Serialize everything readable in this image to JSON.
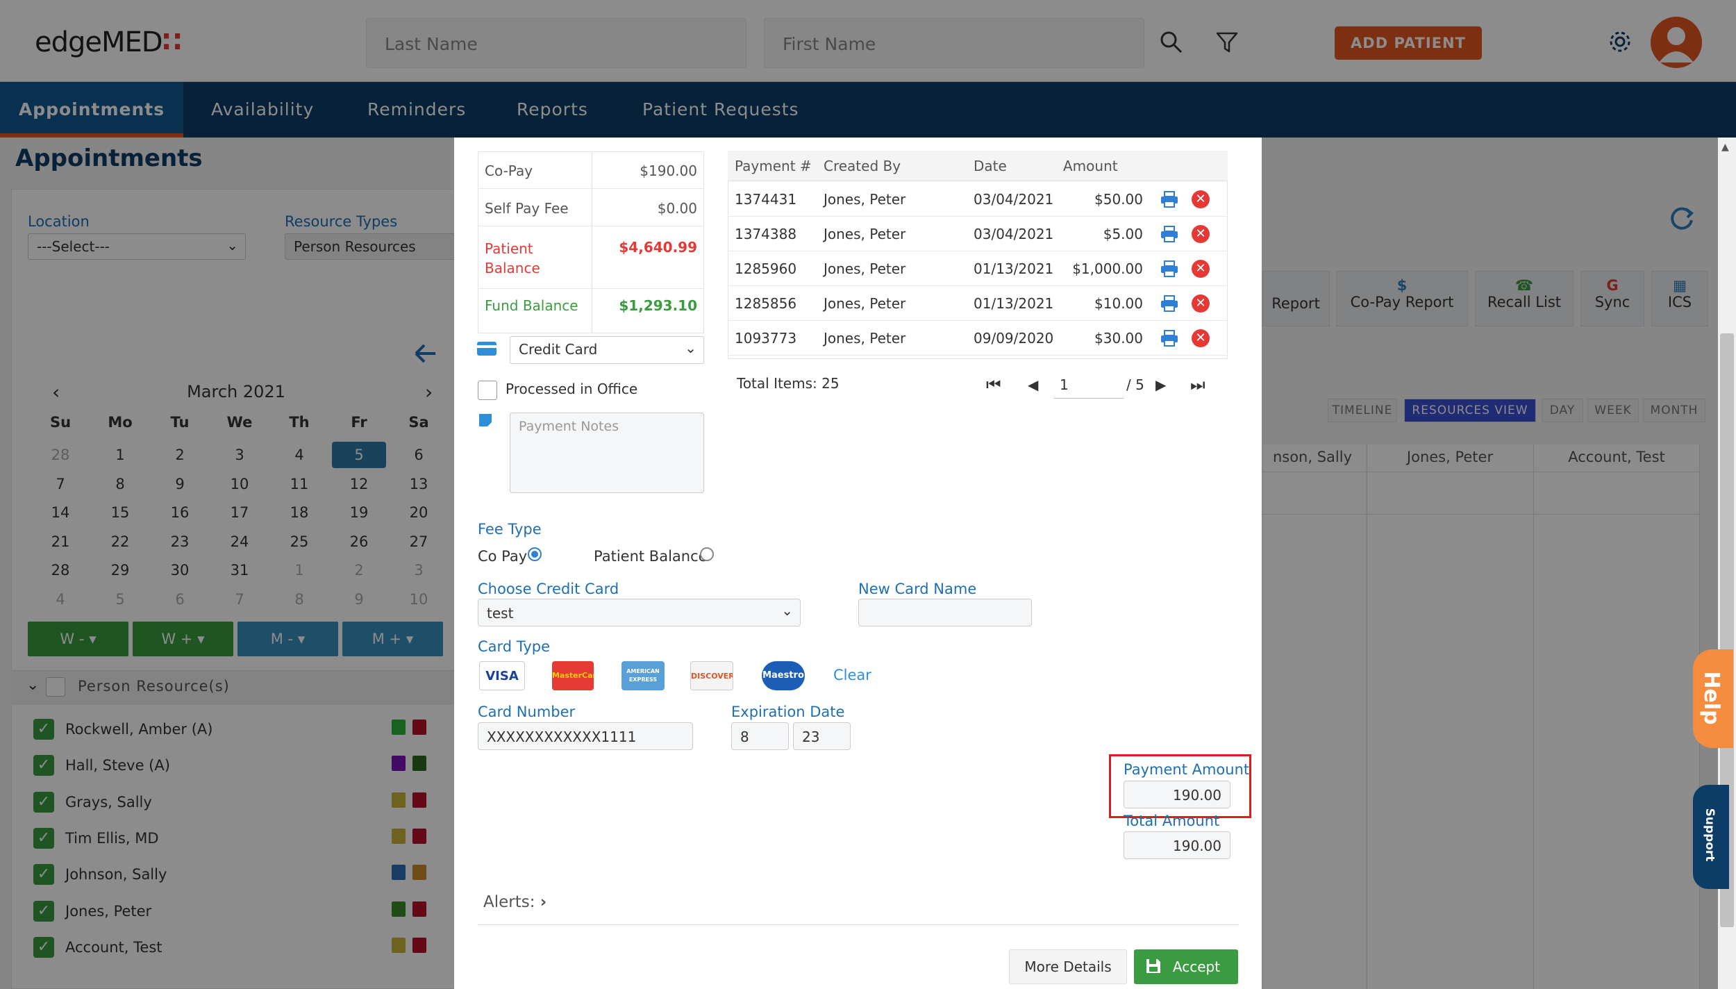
{
  "header": {
    "logo_text": "edgeMED",
    "last_name_placeholder": "Last Name",
    "first_name_placeholder": "First Name",
    "add_patient": "ADD PATIENT"
  },
  "nav": [
    "Appointments",
    "Availability",
    "Reminders",
    "Reports",
    "Patient Requests"
  ],
  "page": {
    "title": "Appointments",
    "location_label": "Location",
    "location_value": "---Select---",
    "resource_types_label": "Resource Types",
    "resource_types_value": "Person Resources",
    "calendar": {
      "month": "March 2021",
      "days": [
        "Su",
        "Mo",
        "Tu",
        "We",
        "Th",
        "Fr",
        "Sa"
      ],
      "weeks": [
        [
          "28",
          "1",
          "2",
          "3",
          "4",
          "5",
          "6"
        ],
        [
          "7",
          "8",
          "9",
          "10",
          "11",
          "12",
          "13"
        ],
        [
          "14",
          "15",
          "16",
          "17",
          "18",
          "19",
          "20"
        ],
        [
          "21",
          "22",
          "23",
          "24",
          "25",
          "26",
          "27"
        ],
        [
          "28",
          "29",
          "30",
          "31",
          "1",
          "2",
          "3"
        ],
        [
          "4",
          "5",
          "6",
          "7",
          "8",
          "9",
          "10"
        ]
      ],
      "selected": "5"
    },
    "week_buttons": [
      "W -",
      "W +",
      "M -",
      "M +"
    ],
    "resources_header": "Person Resource(s)",
    "resources": [
      "Rockwell, Amber (A)",
      "Hall, Steve (A)",
      "Grays, Sally",
      "Tim Ellis, MD",
      "Johnson, Sally",
      "Jones, Peter",
      "Account, Test"
    ],
    "resource_colors": [
      [
        "#2db33a",
        "#b5122a"
      ],
      [
        "#7a14b8",
        "#2f6b1d"
      ],
      [
        "#c9b23a",
        "#b5122a"
      ],
      [
        "#c9b23a",
        "#b5122a"
      ],
      [
        "#2f6fb3",
        "#c98a2a"
      ],
      [
        "#3a8a2a",
        "#b5122a"
      ],
      [
        "#c9b23a",
        "#b5122a"
      ]
    ],
    "report_buttons": [
      "Report",
      "Co-Pay Report",
      "Recall List",
      "Sync",
      "ICS"
    ],
    "view_buttons": [
      "TIMELINE",
      "RESOURCES VIEW",
      "DAY",
      "WEEK",
      "MONTH"
    ],
    "grid_headers": [
      "nson, Sally",
      "Jones, Peter",
      "Account, Test"
    ],
    "help": "Help",
    "support": "Support"
  },
  "modal": {
    "summary": [
      {
        "label": "Co-Pay",
        "value": "$190.00"
      },
      {
        "label": "Self Pay Fee",
        "value": "$0.00"
      },
      {
        "label": "Patient Balance",
        "value": "$4,640.99"
      },
      {
        "label": "Fund Balance",
        "value": "$1,293.10"
      }
    ],
    "payment_method": "Credit Card",
    "processed_in_office": "Processed in Office",
    "payment_notes_placeholder": "Payment Notes",
    "table": {
      "headers": [
        "Payment #",
        "Created By",
        "Date",
        "Amount"
      ],
      "rows": [
        [
          "1374431",
          "Jones, Peter",
          "03/04/2021",
          "$50.00"
        ],
        [
          "1374388",
          "Jones, Peter",
          "03/04/2021",
          "$5.00"
        ],
        [
          "1285960",
          "Jones, Peter",
          "01/13/2021",
          "$1,000.00"
        ],
        [
          "1285856",
          "Jones, Peter",
          "01/13/2021",
          "$10.00"
        ],
        [
          "1093773",
          "Jones, Peter",
          "09/09/2020",
          "$30.00"
        ]
      ],
      "total_items": "Total Items: 25",
      "page": "1",
      "page_total": "/ 5"
    },
    "fee_type_label": "Fee Type",
    "fee_copay": "Co Pay",
    "fee_patient_balance": "Patient Balance",
    "choose_card_label": "Choose Credit Card",
    "choose_card_value": "test",
    "new_card_name_label": "New Card Name",
    "card_type_label": "Card Type",
    "card_types": [
      "VISA",
      "MasterCard",
      "AMERICAN EXPRESS",
      "DISCOVER",
      "Maestro"
    ],
    "clear": "Clear",
    "card_number_label": "Card Number",
    "card_number_value": "XXXXXXXXXXXX1111",
    "expiration_label": "Expiration Date",
    "exp_month": "8",
    "exp_year": "23",
    "payment_amount_label": "Payment Amount",
    "payment_amount_value": "190.00",
    "total_amount_label": "Total Amount",
    "total_amount_value": "190.00",
    "alerts": "Alerts:",
    "more_details": "More Details",
    "accept": "Accept"
  },
  "colors": {
    "navy": "#0b3d66",
    "accent": "#e2571f",
    "green": "#3a9b41",
    "red": "#e53935",
    "link": "#1f6fb3"
  }
}
